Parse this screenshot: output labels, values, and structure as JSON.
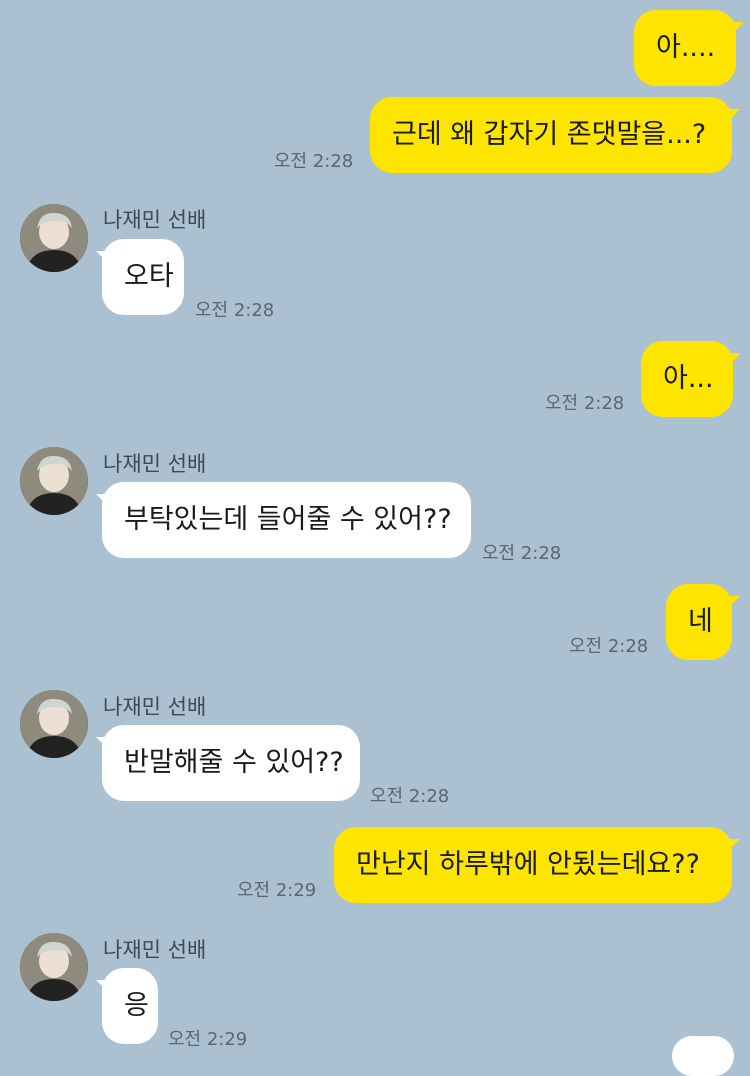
{
  "chat": {
    "sender_name": "나재민 선배",
    "messages": [
      {
        "from": "me",
        "text": "아....",
        "time": ""
      },
      {
        "from": "me",
        "text": "근데 왜 갑자기 존댓말을...?",
        "time": "오전 2:28"
      },
      {
        "from": "other",
        "text": "오타",
        "time": "오전 2:28"
      },
      {
        "from": "me",
        "text": "아...",
        "time": "오전 2:28"
      },
      {
        "from": "other",
        "text": "부탁있는데 들어줄 수 있어??",
        "time": "오전 2:28"
      },
      {
        "from": "me",
        "text": "네",
        "time": "오전 2:28"
      },
      {
        "from": "other",
        "text": "반말해줄 수 있어??",
        "time": "오전 2:28"
      },
      {
        "from": "me",
        "text": "만난지 하루밖에 안됬는데요??",
        "time": "오전 2:29"
      },
      {
        "from": "other",
        "text": "응",
        "time": "오전 2:29"
      }
    ]
  },
  "colors": {
    "background": "#abc1d1",
    "my_bubble": "#fee500",
    "other_bubble": "#ffffff"
  }
}
